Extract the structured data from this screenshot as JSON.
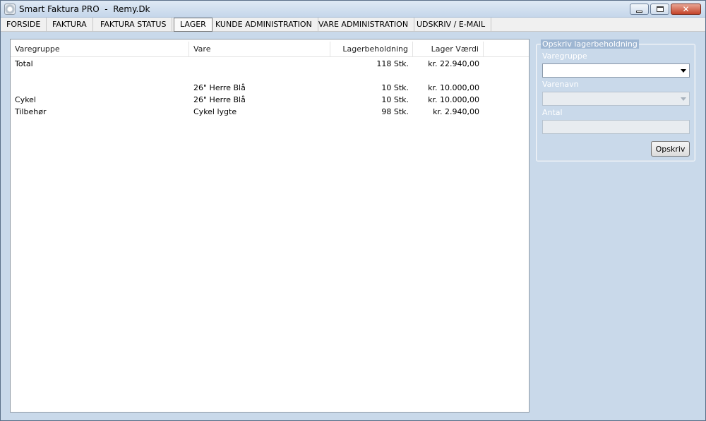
{
  "window": {
    "title": "Smart Faktura PRO  -  Remy.Dk"
  },
  "tabs": [
    {
      "label": "FORSIDE"
    },
    {
      "label": "FAKTURA"
    },
    {
      "label": "FAKTURA STATUS"
    },
    {
      "label": "LAGER",
      "active": true
    },
    {
      "label": "KUNDE ADMINISTRATION"
    },
    {
      "label": "VARE ADMINISTRATION"
    },
    {
      "label": "UDSKRIV / E-MAIL"
    }
  ],
  "table": {
    "columns": [
      "Varegruppe",
      "Vare",
      "Lagerbeholdning",
      "Lager Værdi"
    ],
    "rows": [
      {
        "group": "Total",
        "item": "",
        "stock": "118 Stk.",
        "value": "kr. 22.940,00"
      },
      {
        "group": "",
        "item": "",
        "stock": "",
        "value": ""
      },
      {
        "group": "",
        "item": "26\" Herre Blå",
        "stock": "10 Stk.",
        "value": "kr. 10.000,00"
      },
      {
        "group": "Cykel",
        "item": "26\" Herre Blå",
        "stock": "10 Stk.",
        "value": "kr. 10.000,00"
      },
      {
        "group": "Tilbehør",
        "item": "Cykel lygte",
        "stock": "98 Stk.",
        "value": "kr. 2.940,00"
      }
    ]
  },
  "sidebar": {
    "group_title": "Opskriv lagerbeholdning",
    "varegruppe_label": "Varegruppe",
    "varegruppe_value": "",
    "varenavn_label": "Varenavn",
    "varenavn_value": "",
    "antal_label": "Antal",
    "antal_value": "",
    "submit_label": "Opskriv"
  },
  "colors": {
    "background": "#9eb6d2",
    "panel_border": "#8f9aa6",
    "close_button": "#c4442a"
  }
}
